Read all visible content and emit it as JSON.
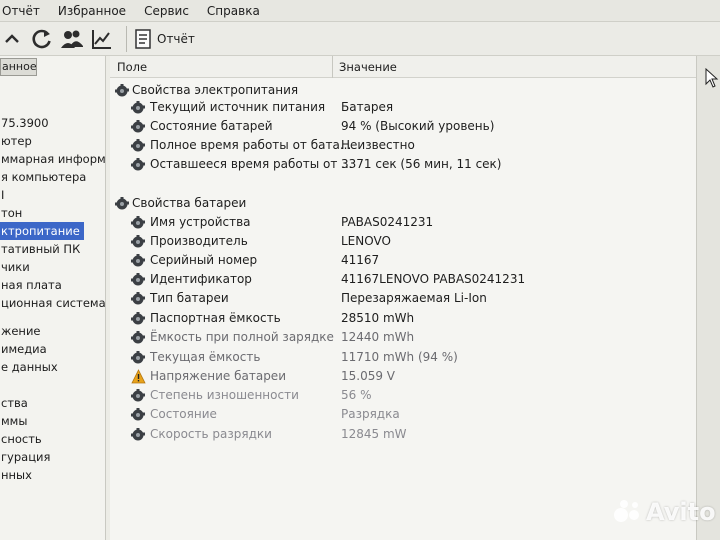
{
  "menu": [
    "Отчёт",
    "Избранное",
    "Сервис",
    "Справка"
  ],
  "toolbar": {
    "report_label": "Отчёт"
  },
  "left": {
    "tab_label": "анное",
    "items": [
      "75.3900",
      "ютер",
      "ммарная информа",
      "я компьютера",
      "I",
      "тон",
      "ктропитание",
      "тативный ПК",
      "чики",
      "ная плата",
      "ционная система",
      "жение",
      "имедиа",
      "е данных",
      "ства",
      "ммы",
      "сность",
      "гурация",
      "нных"
    ],
    "selected_index": 6
  },
  "columns": {
    "field": "Поле",
    "value": "Значение"
  },
  "groups": [
    {
      "title": "Свойства электропитания",
      "rows": [
        {
          "field": "Текущий источник питания",
          "value": "Батарея"
        },
        {
          "field": "Состояние батарей",
          "value": "94 % (Высокий уровень)"
        },
        {
          "field": "Полное время работы от бата...",
          "value": "Неизвестно"
        },
        {
          "field": "Оставшееся время работы от ...",
          "value": "3371 сек (56 мин, 11 сек)"
        }
      ]
    },
    {
      "title": "Свойства батареи",
      "rows": [
        {
          "field": "Имя устройства",
          "value": "PABAS0241231"
        },
        {
          "field": "Производитель",
          "value": "LENOVO"
        },
        {
          "field": "Серийный номер",
          "value": "41167"
        },
        {
          "field": "Идентификатор",
          "value": "41167LENOVO PABAS0241231"
        },
        {
          "field": "Тип батареи",
          "value": "Перезаряжаемая Li-Ion"
        },
        {
          "field": "Паспортная ёмкость",
          "value": "28510 mWh"
        },
        {
          "field": "Ёмкость при полной зарядке",
          "value": "12440 mWh"
        },
        {
          "field": "Текущая ёмкость",
          "value": "11710 mWh  (94 %)"
        },
        {
          "field": "Напряжение батареи",
          "value": "15.059 V"
        },
        {
          "field": "Степень изношенности",
          "value": "56 %"
        },
        {
          "field": "Состояние",
          "value": "Разрядка"
        },
        {
          "field": "Скорость разрядки",
          "value": "12845 mW"
        }
      ]
    }
  ],
  "watermark": "Avito",
  "colors": {
    "selection": "#3c67c8",
    "warning": "#e8a21a",
    "icon": "#3b3f44"
  }
}
